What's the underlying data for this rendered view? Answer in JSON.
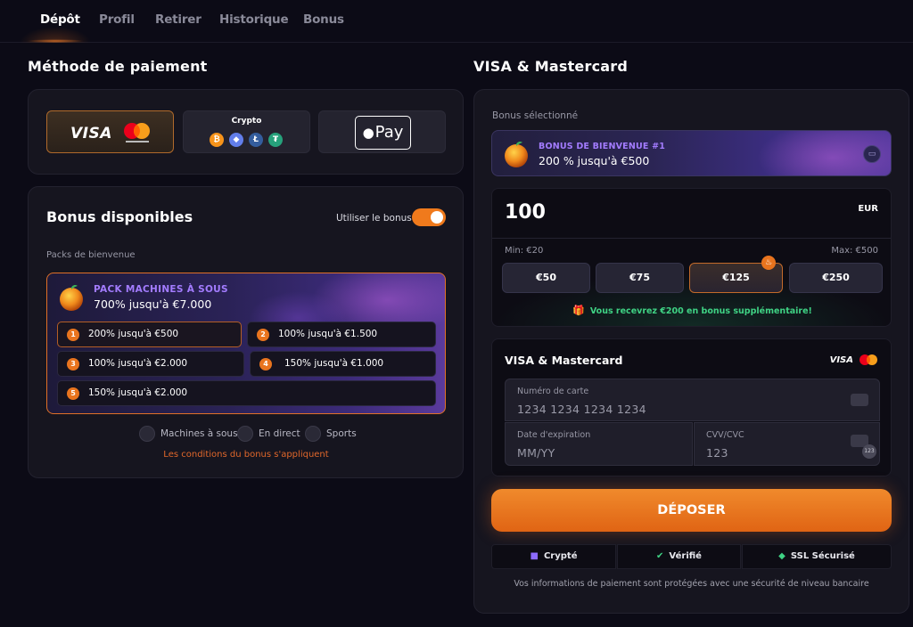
{
  "tabs": [
    {
      "label": "Dépôt",
      "active": true
    },
    {
      "label": "Profil",
      "active": false
    },
    {
      "label": "Retirer",
      "active": false
    },
    {
      "label": "Historique",
      "active": false
    },
    {
      "label": "Bonus",
      "active": false
    }
  ],
  "payment_method": {
    "title": "Méthode de paiement",
    "options": [
      {
        "name": "visa-mastercard",
        "visa_text": "VISA",
        "selected": true
      },
      {
        "name": "crypto",
        "label": "Crypto",
        "coins": [
          "bitcoin",
          "ethereum",
          "litecoin",
          "tether"
        ]
      },
      {
        "name": "apple-pay",
        "label": "Pay"
      }
    ]
  },
  "bonus_panel": {
    "title": "Bonus disponibles",
    "use_bonus_label": "Utiliser le bonus",
    "use_bonus_on": true,
    "packs_label": "Packs de bienvenue",
    "pack": {
      "name": "PACK MACHINES À SOUS",
      "subtitle": "700% jusqu'à €7.000",
      "tiers": [
        {
          "num": "1",
          "text": "200% jusqu'à €500"
        },
        {
          "num": "2",
          "text": "100% jusqu'à €1.500"
        },
        {
          "num": "3",
          "text": "100% jusqu'à €2.000"
        },
        {
          "num": "4",
          "text": "150% jusqu'à €1.000"
        },
        {
          "num": "5",
          "text": "150% jusqu'à €2.000"
        }
      ]
    },
    "tags": [
      "Machines à sous",
      "En direct",
      "Sports"
    ],
    "conditions": "Les conditions du bonus s'appliquent"
  },
  "right_panel": {
    "title": "VISA & Mastercard",
    "selected_bonus_label": "Bonus sélectionné",
    "selected_bonus": {
      "name": "BONUS DE BIENVENUE #1",
      "subtitle": "200 % jusqu'à €500"
    },
    "amount": {
      "value": "100",
      "currency": "EUR",
      "min": "Min: €20",
      "max": "Max: €500",
      "presets": [
        "€50",
        "€75",
        "€125",
        "€250"
      ],
      "extra_bonus": "Vous recevrez €200 en bonus supplémentaire!"
    },
    "card_form": {
      "title": "VISA & Mastercard",
      "visa_text": "VISA",
      "card_number_label": "Numéro de carte",
      "card_number_placeholder": "1234 1234 1234 1234",
      "expiry_label": "Date d'expiration",
      "expiry_placeholder": "MM/YY",
      "cvc_label": "CVV/CVC",
      "cvc_placeholder": "123",
      "cvc_badge": "123"
    },
    "deposit_label": "DÉPOSER",
    "security": [
      "Crypté",
      "Vérifié",
      "SSL Sécurisé"
    ],
    "footer_note": "Vos informations de paiement sont protégées avec une sécurité de niveau bancaire"
  },
  "colors": {
    "accent": "#f07a1c",
    "background": "#0c0b16",
    "panel": "#16151f",
    "purple": "#a37cff",
    "green": "#3fd284"
  }
}
